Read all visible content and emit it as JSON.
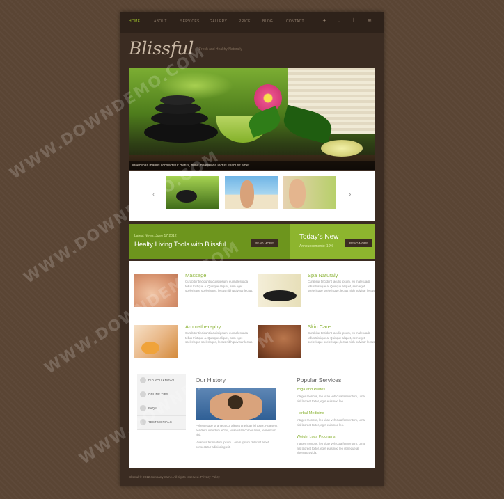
{
  "nav": {
    "items": [
      "HOME",
      "ABOUT",
      "SERVICES",
      "GALLERY",
      "PRICE",
      "BLOG",
      "CONTACT"
    ],
    "social_icons": [
      "twitter-icon",
      "social-icon",
      "facebook-icon",
      "rss-icon"
    ]
  },
  "header": {
    "logo": "Blissful",
    "tagline": "Fresh and Healthy Naturally"
  },
  "slider": {
    "caption": "Maecenas mauris consectetur metus, nunc malesuada lectus etiam sit amet"
  },
  "banner": {
    "date": "Latest News: June 17 2012",
    "title": "Healty Living Tools with Blissful",
    "read_more": "READ MORE",
    "today_title": "Today's New",
    "announcements": "Announcements: 10%",
    "today_read_more": "READ MORE"
  },
  "services": [
    {
      "title": "Massage",
      "text": "Curabitur tincidunt iaculis ipsum, eu malesuada tellus tristique a. Quisque aliquet, sem eget scelerisque scelerisque, lectus nibh pulvinar lectus."
    },
    {
      "title": "Spa Naturaly",
      "text": "Curabitur tincidunt iaculis ipsum, eu malesuada tellus tristique a. Quisque aliquet, sem eget scelerisque scelerisque, lectus nibh pulvinar lectus."
    },
    {
      "title": "Aromatheraphy",
      "text": "Curabitur tincidunt iaculis ipsum, eu malesuada tellus tristique a. Quisque aliquet, sem eget scelerisque scelerisque, lectus nibh pulvinar lectus."
    },
    {
      "title": "Skin Care",
      "text": "Curabitur tincidunt iaculis ipsum, eu malesuada tellus tristique a. Quisque aliquet, sem eget scelerisque scelerisque, lectus nibh pulvinar lectus."
    }
  ],
  "sidebar": {
    "items": [
      "DID YOU KNOW?",
      "ONLINE TIPS",
      "FAQS",
      "TESTIMONIALS"
    ]
  },
  "history": {
    "title": "Our History",
    "text1": "Pellentesque ut ante arcu, aliquet gravida nisl tortor. Praesent hendrerit interdum lectus, vitae ullamcorper risus, fermentum nisl.",
    "text2": "Vivamus fermentum ipsum. Lorem ipsum dolor sit amet, consectetur adipiscing elit."
  },
  "popular": {
    "title": "Popular Services",
    "items": [
      {
        "title": "Yoga and Pilates",
        "text": "Integer rhoncus, leo vitae vehicula fermentum, urna nisl laoreet tortor, eget euismod leo."
      },
      {
        "title": "Herbal Medicine",
        "text": "Integer rhoncus, leo vitae vehicula fermentum, urna nisl laoreet tortor, eget euismod leo."
      },
      {
        "title": "Weight Loss Programs",
        "text": "Integer rhoncus, leo vitae vehicula fermentum, urna nisl laoreet tortor, eget euismod leo ut neque at viverra gravida."
      }
    ]
  },
  "footer": {
    "copyright": "Blissful © 2012 company name. All rights reserved. Privacy Policy"
  },
  "watermark": "WWW.DOWNDEMO.COM",
  "colors": {
    "accent": "#8ab234",
    "banner": "#6d951d",
    "panel": "#3b2c22",
    "background": "#5a4534"
  }
}
